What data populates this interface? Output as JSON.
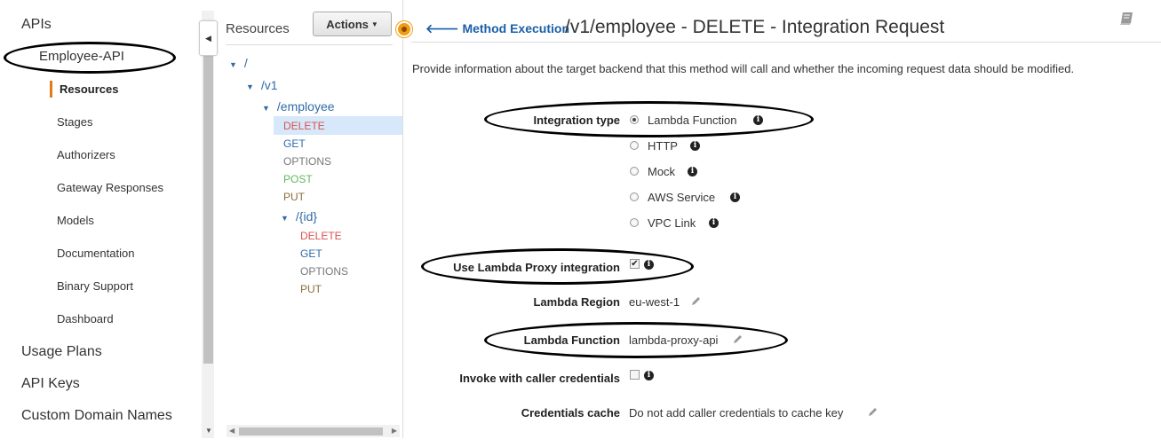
{
  "nav": {
    "apis": "APIs",
    "api_name": "Employee-API",
    "items": [
      "Resources",
      "Stages",
      "Authorizers",
      "Gateway Responses",
      "Models",
      "Documentation",
      "Binary Support",
      "Dashboard"
    ],
    "bottom": [
      "Usage Plans",
      "API Keys",
      "Custom Domain Names"
    ]
  },
  "resources": {
    "title": "Resources",
    "actions_label": "Actions",
    "tree": {
      "root": "/",
      "v1": "/v1",
      "employee": "/employee",
      "employee_methods": [
        "DELETE",
        "GET",
        "OPTIONS",
        "POST",
        "PUT"
      ],
      "id": "/{id}",
      "id_methods": [
        "DELETE",
        "GET",
        "OPTIONS",
        "PUT"
      ]
    }
  },
  "main": {
    "back_label": "Method Execution",
    "title": "/v1/employee - DELETE - Integration Request",
    "description": "Provide information about the target backend that this method will call and whether the incoming request data should be modified.",
    "integration_type_label": "Integration type",
    "integration_options": [
      "Lambda Function",
      "HTTP",
      "Mock",
      "AWS Service",
      "VPC Link"
    ],
    "selected_option": "Lambda Function",
    "proxy_label": "Use Lambda Proxy integration",
    "proxy_checked": true,
    "region_label": "Lambda Region",
    "region_value": "eu-west-1",
    "function_label": "Lambda Function",
    "function_value": "lambda-proxy-api",
    "invoke_label": "Invoke with caller credentials",
    "invoke_checked": false,
    "cache_label": "Credentials cache",
    "cache_value": "Do not add caller credentials to cache key"
  },
  "colors": {
    "accent_orange": "#e07b1c",
    "link_blue": "#1a5fa8",
    "delete_red": "#d9534f",
    "post_green": "#5cb85c",
    "selected_row": "#d6e8f9"
  }
}
